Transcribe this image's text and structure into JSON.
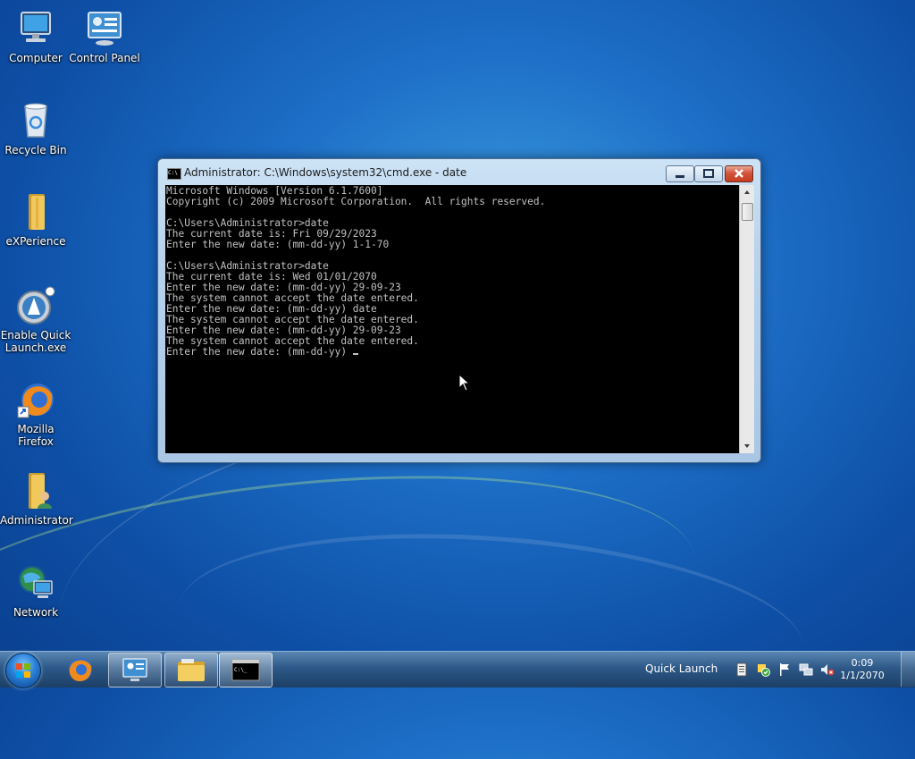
{
  "desktop": {
    "icons": [
      {
        "label": "Computer",
        "icon": "computer-icon"
      },
      {
        "label": "Control Panel",
        "icon": "control-panel-icon"
      },
      {
        "label": "Recycle Bin",
        "icon": "recycle-bin-icon"
      },
      {
        "label": "eXPerience",
        "icon": "folder-icon"
      },
      {
        "label": "Enable Quick Launch.exe",
        "icon": "quick-launch-app-icon"
      },
      {
        "label": "Mozilla Firefox",
        "icon": "firefox-icon"
      },
      {
        "label": "Administrator",
        "icon": "user-folder-icon"
      },
      {
        "label": "Network",
        "icon": "network-icon"
      }
    ]
  },
  "window": {
    "title": "Administrator: C:\\Windows\\system32\\cmd.exe - date",
    "console_lines": [
      "Microsoft Windows [Version 6.1.7600]",
      "Copyright (c) 2009 Microsoft Corporation.  All rights reserved.",
      "",
      "C:\\Users\\Administrator>date",
      "The current date is: Fri 09/29/2023",
      "Enter the new date: (mm-dd-yy) 1-1-70",
      "",
      "C:\\Users\\Administrator>date",
      "The current date is: Wed 01/01/2070",
      "Enter the new date: (mm-dd-yy) 29-09-23",
      "The system cannot accept the date entered.",
      "Enter the new date: (mm-dd-yy) date",
      "The system cannot accept the date entered.",
      "Enter the new date: (mm-dd-yy) 29-09-23",
      "The system cannot accept the date entered.",
      "Enter the new date: (mm-dd-yy) "
    ],
    "colors": {
      "console_bg": "#000000",
      "console_fg": "#c0c0c0"
    }
  },
  "taskbar": {
    "quick_launch_label": "Quick Launch",
    "clock_time": "0:09",
    "clock_date": "1/1/2070",
    "buttons": [
      "start-orb-icon",
      "firefox-icon",
      "control-panel-icon",
      "explorer-folder-icon",
      "cmd-icon"
    ],
    "tray_icons": [
      "action-center-doc-icon",
      "security-check-icon",
      "flag-icon",
      "network-tray-icon",
      "volume-muted-icon"
    ]
  }
}
